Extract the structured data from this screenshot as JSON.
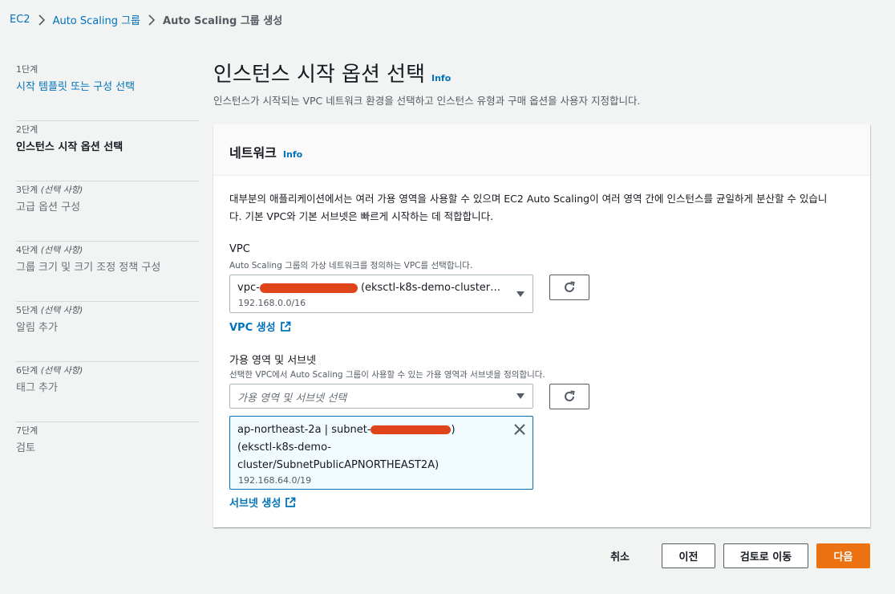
{
  "breadcrumb": {
    "items": [
      "EC2",
      "Auto Scaling 그룹"
    ],
    "current": "Auto Scaling 그룹 생성"
  },
  "steps": [
    {
      "num": "1단계",
      "optional": "",
      "title": "시작 템플릿 또는 구성 선택",
      "state": "link"
    },
    {
      "num": "2단계",
      "optional": "",
      "title": "인스턴스 시작 옵션 선택",
      "state": "active"
    },
    {
      "num": "3단계",
      "optional": "(선택 사항)",
      "title": "고급 옵션 구성",
      "state": "disabled"
    },
    {
      "num": "4단계",
      "optional": "(선택 사항)",
      "title": "그룹 크기 및 크기 조정 정책 구성",
      "state": "disabled"
    },
    {
      "num": "5단계",
      "optional": "(선택 사항)",
      "title": "알림 추가",
      "state": "disabled"
    },
    {
      "num": "6단계",
      "optional": "(선택 사항)",
      "title": "태그 추가",
      "state": "disabled"
    },
    {
      "num": "7단계",
      "optional": "",
      "title": "검토",
      "state": "disabled"
    }
  ],
  "page": {
    "title": "인스턴스 시작 옵션 선택",
    "info": "Info",
    "description": "인스턴스가 시작되는 VPC 네트워크 환경을 선택하고 인스턴스 유형과 구매 옵션을 사용자 지정합니다."
  },
  "network": {
    "title": "네트워크",
    "info": "Info",
    "description_line1": "대부분의 애플리케이션에서는 여러 가용 영역을 사용할 수 있으며 EC2 Auto Scaling이 여러 영역 간에 인스턴스를 균일하게 분산할 수 있습니",
    "description_line2": "다. 기본 VPC와 기본 서브넷은 빠르게 시작하는 데 적합합니다.",
    "vpc": {
      "label": "VPC",
      "description": "Auto Scaling 그룹의 가상 네트워크를 정의하는 VPC를 선택합니다.",
      "value_prefix": "vpc-",
      "value_suffix": "(eksctl-k8s-demo-cluster…",
      "cidr": "192.168.0.0/16",
      "create_link": "VPC 생성"
    },
    "subnets": {
      "label": "가용 영역 및 서브넷",
      "description": "선택한 VPC에서 Auto Scaling 그룹이 사용할 수 있는 가용 영역과 서브넷을 정의합니다.",
      "placeholder": "가용 영역 및 서브넷 선택",
      "token": {
        "line1_prefix": "ap-northeast-2a | subnet-",
        "line1_suffix": ")",
        "line2": "(eksctl-k8s-demo-",
        "line3": "cluster/SubnetPublicAPNORTHEAST2A)",
        "cidr": "192.168.64.0/19"
      },
      "create_link": "서브넷 생성"
    }
  },
  "footer": {
    "cancel": "취소",
    "previous": "이전",
    "review": "검토로 이동",
    "next": "다음"
  },
  "colors": {
    "link": "#0073bb",
    "primary_button": "#ec7211",
    "redaction": "#e0441a"
  }
}
